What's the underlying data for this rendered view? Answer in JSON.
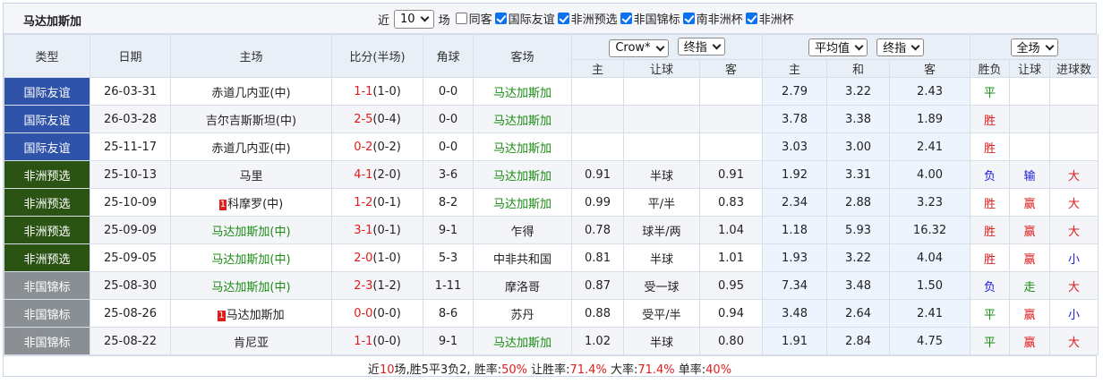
{
  "header": {
    "team": "马达加斯加",
    "recent_prefix": "近",
    "recent_count": "10",
    "recent_suffix": "场",
    "filters": [
      {
        "label": "同客",
        "checked": false
      },
      {
        "label": "国际友谊",
        "checked": true
      },
      {
        "label": "非洲预选",
        "checked": true
      },
      {
        "label": "非国锦标",
        "checked": true
      },
      {
        "label": "南非洲杯",
        "checked": true
      },
      {
        "label": "非洲杯",
        "checked": true
      }
    ]
  },
  "columns": {
    "type": "类型",
    "date": "日期",
    "home": "主场",
    "score": "比分(半场)",
    "corner": "角球",
    "away": "客场",
    "company": "Crow*",
    "handicap_mode": "终指",
    "avg_label": "平均值",
    "euro_mode": "终指",
    "sub_home": "主",
    "sub_handicap": "让球",
    "sub_away": "客",
    "sub_e_home": "主",
    "sub_e_draw": "和",
    "sub_e_away": "客",
    "scope": "全场",
    "result": "胜负",
    "handicap_result": "让球",
    "goals": "进球数"
  },
  "rows": [
    {
      "type": "国际友谊",
      "type_class": "type-a",
      "date": "26-03-31",
      "home": "赤道几内亚(中)",
      "home_rank": "",
      "home_team": false,
      "score": "1-1",
      "half": "(1-0)",
      "corner": "0-0",
      "away": "马达加斯加",
      "away_team": true,
      "h_home": "",
      "h_line": "",
      "h_away": "",
      "e_home": "2.79",
      "e_draw": "3.22",
      "e_away": "2.43",
      "result": "平",
      "result_color": "green",
      "hres": "",
      "hres_color": "",
      "goals": "",
      "goals_color": ""
    },
    {
      "type": "国际友谊",
      "type_class": "type-a",
      "date": "26-03-28",
      "home": "吉尔吉斯斯坦(中)",
      "home_rank": "",
      "home_team": false,
      "score": "2-5",
      "half": "(0-4)",
      "corner": "0-0",
      "away": "马达加斯加",
      "away_team": true,
      "h_home": "",
      "h_line": "",
      "h_away": "",
      "e_home": "3.78",
      "e_draw": "3.38",
      "e_away": "1.89",
      "result": "胜",
      "result_color": "red",
      "hres": "",
      "hres_color": "",
      "goals": "",
      "goals_color": ""
    },
    {
      "type": "国际友谊",
      "type_class": "type-a",
      "date": "25-11-17",
      "home": "赤道几内亚(中)",
      "home_rank": "",
      "home_team": false,
      "score": "0-2",
      "half": "(0-2)",
      "corner": "0-0",
      "away": "马达加斯加",
      "away_team": true,
      "h_home": "",
      "h_line": "",
      "h_away": "",
      "e_home": "3.03",
      "e_draw": "3.00",
      "e_away": "2.41",
      "result": "胜",
      "result_color": "red",
      "hres": "",
      "hres_color": "",
      "goals": "",
      "goals_color": ""
    },
    {
      "type": "非洲预选",
      "type_class": "type-b",
      "date": "25-10-13",
      "home": "马里",
      "home_rank": "",
      "home_team": false,
      "score": "4-1",
      "half": "(2-0)",
      "corner": "3-6",
      "away": "马达加斯加",
      "away_team": true,
      "h_home": "0.91",
      "h_line": "半球",
      "h_away": "0.91",
      "e_home": "1.92",
      "e_draw": "3.31",
      "e_away": "4.00",
      "result": "负",
      "result_color": "blue",
      "hres": "输",
      "hres_color": "blue",
      "goals": "大",
      "goals_color": "red"
    },
    {
      "type": "非洲预选",
      "type_class": "type-b",
      "date": "25-10-09",
      "home": "科摩罗(中)",
      "home_rank": "1",
      "home_team": false,
      "score": "1-2",
      "half": "(0-1)",
      "corner": "8-2",
      "away": "马达加斯加",
      "away_team": true,
      "h_home": "0.99",
      "h_line": "平/半",
      "h_away": "0.83",
      "e_home": "2.34",
      "e_draw": "2.88",
      "e_away": "3.23",
      "result": "胜",
      "result_color": "red",
      "hres": "赢",
      "hres_color": "red",
      "goals": "大",
      "goals_color": "red"
    },
    {
      "type": "非洲预选",
      "type_class": "type-b",
      "date": "25-09-09",
      "home": "马达加斯加(中)",
      "home_rank": "",
      "home_team": true,
      "score": "3-1",
      "half": "(0-1)",
      "corner": "9-1",
      "away": "乍得",
      "away_team": false,
      "h_home": "0.78",
      "h_line": "球半/两",
      "h_away": "1.04",
      "e_home": "1.18",
      "e_draw": "5.93",
      "e_away": "16.32",
      "result": "胜",
      "result_color": "red",
      "hres": "赢",
      "hres_color": "red",
      "goals": "大",
      "goals_color": "red"
    },
    {
      "type": "非洲预选",
      "type_class": "type-b",
      "date": "25-09-05",
      "home": "马达加斯加(中)",
      "home_rank": "",
      "home_team": true,
      "score": "2-0",
      "half": "(1-0)",
      "corner": "5-3",
      "away": "中非共和国",
      "away_team": false,
      "h_home": "0.81",
      "h_line": "半球",
      "h_away": "1.01",
      "e_home": "1.93",
      "e_draw": "3.22",
      "e_away": "4.04",
      "result": "胜",
      "result_color": "red",
      "hres": "赢",
      "hres_color": "red",
      "goals": "小",
      "goals_color": "blue"
    },
    {
      "type": "非国锦标",
      "type_class": "type-c",
      "date": "25-08-30",
      "home": "马达加斯加(中)",
      "home_rank": "",
      "home_team": true,
      "score": "2-3",
      "half": "(1-2)",
      "corner": "1-11",
      "away": "摩洛哥",
      "away_team": false,
      "h_home": "0.87",
      "h_line": "受一球",
      "h_away": "0.95",
      "e_home": "7.34",
      "e_draw": "3.48",
      "e_away": "1.50",
      "result": "负",
      "result_color": "blue",
      "hres": "走",
      "hres_color": "green",
      "goals": "大",
      "goals_color": "red"
    },
    {
      "type": "非国锦标",
      "type_class": "type-c",
      "date": "25-08-26",
      "home": "马达加斯加",
      "home_rank": "1",
      "home_team": false,
      "score": "0-0",
      "half": "(0-0)",
      "corner": "8-6",
      "away": "苏丹",
      "away_team": false,
      "h_home": "0.88",
      "h_line": "受平/半",
      "h_away": "0.94",
      "e_home": "3.48",
      "e_draw": "2.64",
      "e_away": "2.41",
      "result": "平",
      "result_color": "green",
      "hres": "赢",
      "hres_color": "red",
      "goals": "小",
      "goals_color": "blue"
    },
    {
      "type": "非国锦标",
      "type_class": "type-c",
      "date": "25-08-22",
      "home": "肯尼亚",
      "home_rank": "",
      "home_team": false,
      "score": "1-1",
      "half": "(0-0)",
      "corner": "9-1",
      "away": "马达加斯加",
      "away_team": true,
      "h_home": "1.02",
      "h_line": "半球",
      "h_away": "0.80",
      "e_home": "1.91",
      "e_draw": "2.84",
      "e_away": "4.75",
      "result": "平",
      "result_color": "green",
      "hres": "赢",
      "hres_color": "red",
      "goals": "大",
      "goals_color": "red"
    }
  ],
  "summary": {
    "prefix": "近",
    "count": "10",
    "mid": "场,胜5平3负2, 胜率:",
    "win_rate": "50%",
    "hc_label": " 让胜率:",
    "hc_rate": "71.4%",
    "big_label": " 大率:",
    "big_rate": "71.4%",
    "odd_label": " 单率:",
    "odd_rate": "40%"
  }
}
